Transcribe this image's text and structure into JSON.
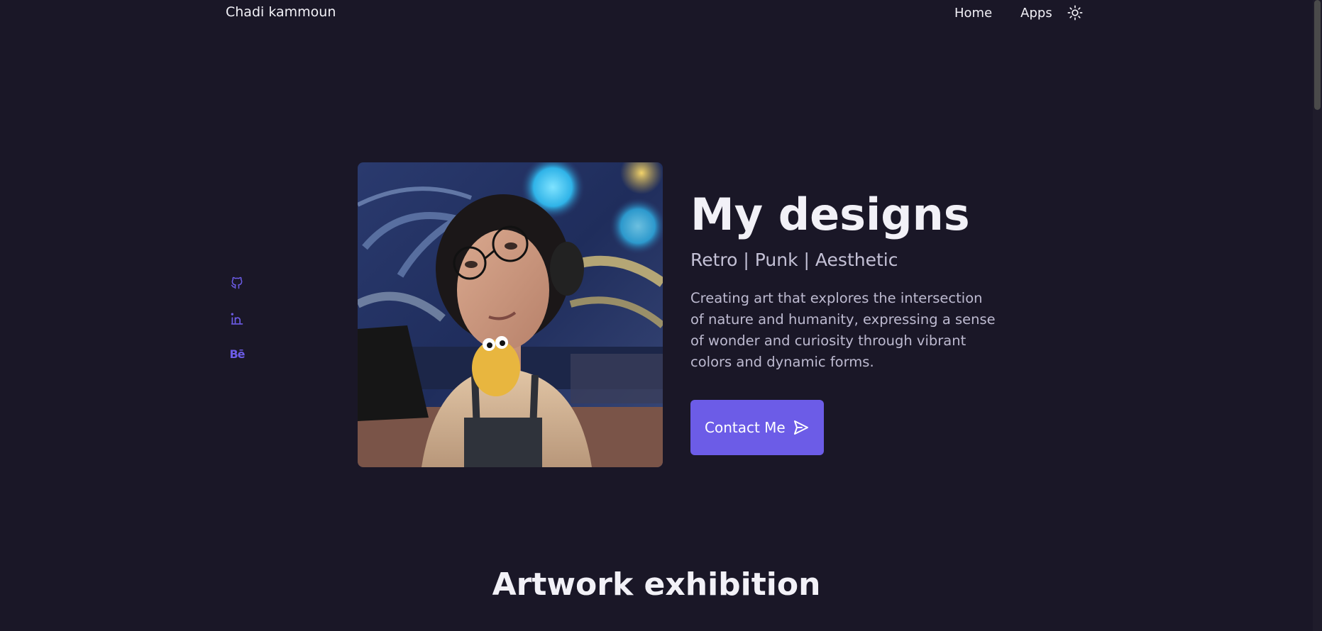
{
  "header": {
    "logo_text": "Chadi kammoun",
    "nav": {
      "home_label": "Home",
      "apps_label": "Apps"
    },
    "theme_toggle_icon": "sun-icon"
  },
  "social": [
    {
      "icon": "github-icon"
    },
    {
      "icon": "linkedin-icon"
    },
    {
      "icon": "behance-icon",
      "glyph": "Bē"
    }
  ],
  "hero": {
    "image_alt_icon": "portrait-artwork",
    "title": "My designs",
    "subtitle": "Retro | Punk | Aesthetic",
    "description": "Creating art that explores the intersection of nature and humanity, expressing a sense of wonder and curiosity through vibrant colors and dynamic forms.",
    "contact_label": "Contact Me"
  },
  "section": {
    "title": "Artwork exhibition"
  },
  "colors": {
    "background": "#1a1727",
    "accent": "#6c5ce7",
    "text": "#f2f1f7",
    "muted_text": "#bdbad0"
  }
}
